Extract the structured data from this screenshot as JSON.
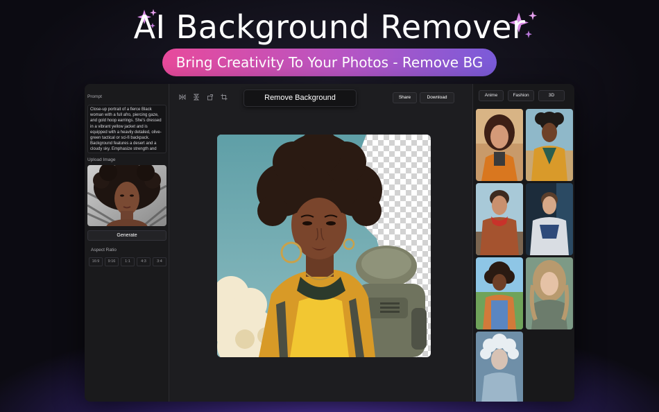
{
  "hero": {
    "title": "AI Background Remover",
    "subtitle": "Bring Creativity To Your Photos - Remove BG"
  },
  "left_panel": {
    "prompt_label": "Prompt",
    "prompt_text": "Close-up portrait of a fierce Black woman with a full afro, piercing gaze, and gold hoop earrings. She's dressed in a vibrant yellow jacket and is equipped with a heavily detailed, olive-green tactical or sci-fi backpack. Background features a desert and a cloudy sky. Emphasize strength and readiness.",
    "upload_label": "Upload Image",
    "generate_label": "Generate",
    "aspect_label": "Aspect Ratio",
    "aspect_ratios": [
      "16:9",
      "9:16",
      "1:1",
      "4:3",
      "3:4"
    ]
  },
  "toolbar": {
    "remove_label": "Remove Background",
    "share_label": "Share",
    "download_label": "Download"
  },
  "right_panel": {
    "tabs": [
      "Anime",
      "Fashion",
      "3D"
    ]
  },
  "colors": {
    "pill_start": "#e84a9b",
    "pill_end": "#7a5bd9",
    "panel_bg": "#1e1e21",
    "sparkle": "#d98ae6"
  }
}
